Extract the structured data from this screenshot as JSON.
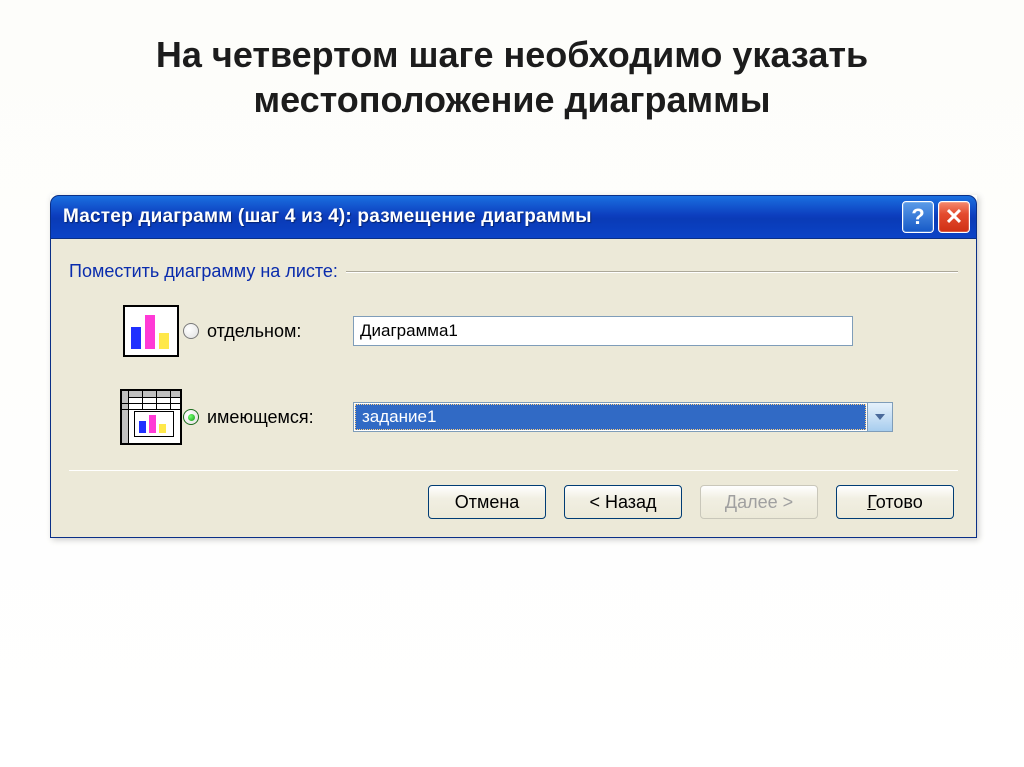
{
  "slide": {
    "heading": "На четвертом шаге необходимо указать местоположение диаграммы"
  },
  "dialog": {
    "title": "Мастер диаграмм (шаг 4 из 4): размещение диаграммы",
    "group_label": "Поместить диаграмму на листе:",
    "option_separate": {
      "label": "отдельном:",
      "value": "Диаграмма1",
      "checked": false
    },
    "option_existing": {
      "label": "имеющемся:",
      "value": "задание1",
      "checked": true
    },
    "buttons": {
      "cancel": "Отмена",
      "back": "< Назад",
      "next": "Далее >",
      "finish_prefix": "Г",
      "finish_rest": "отово"
    }
  }
}
